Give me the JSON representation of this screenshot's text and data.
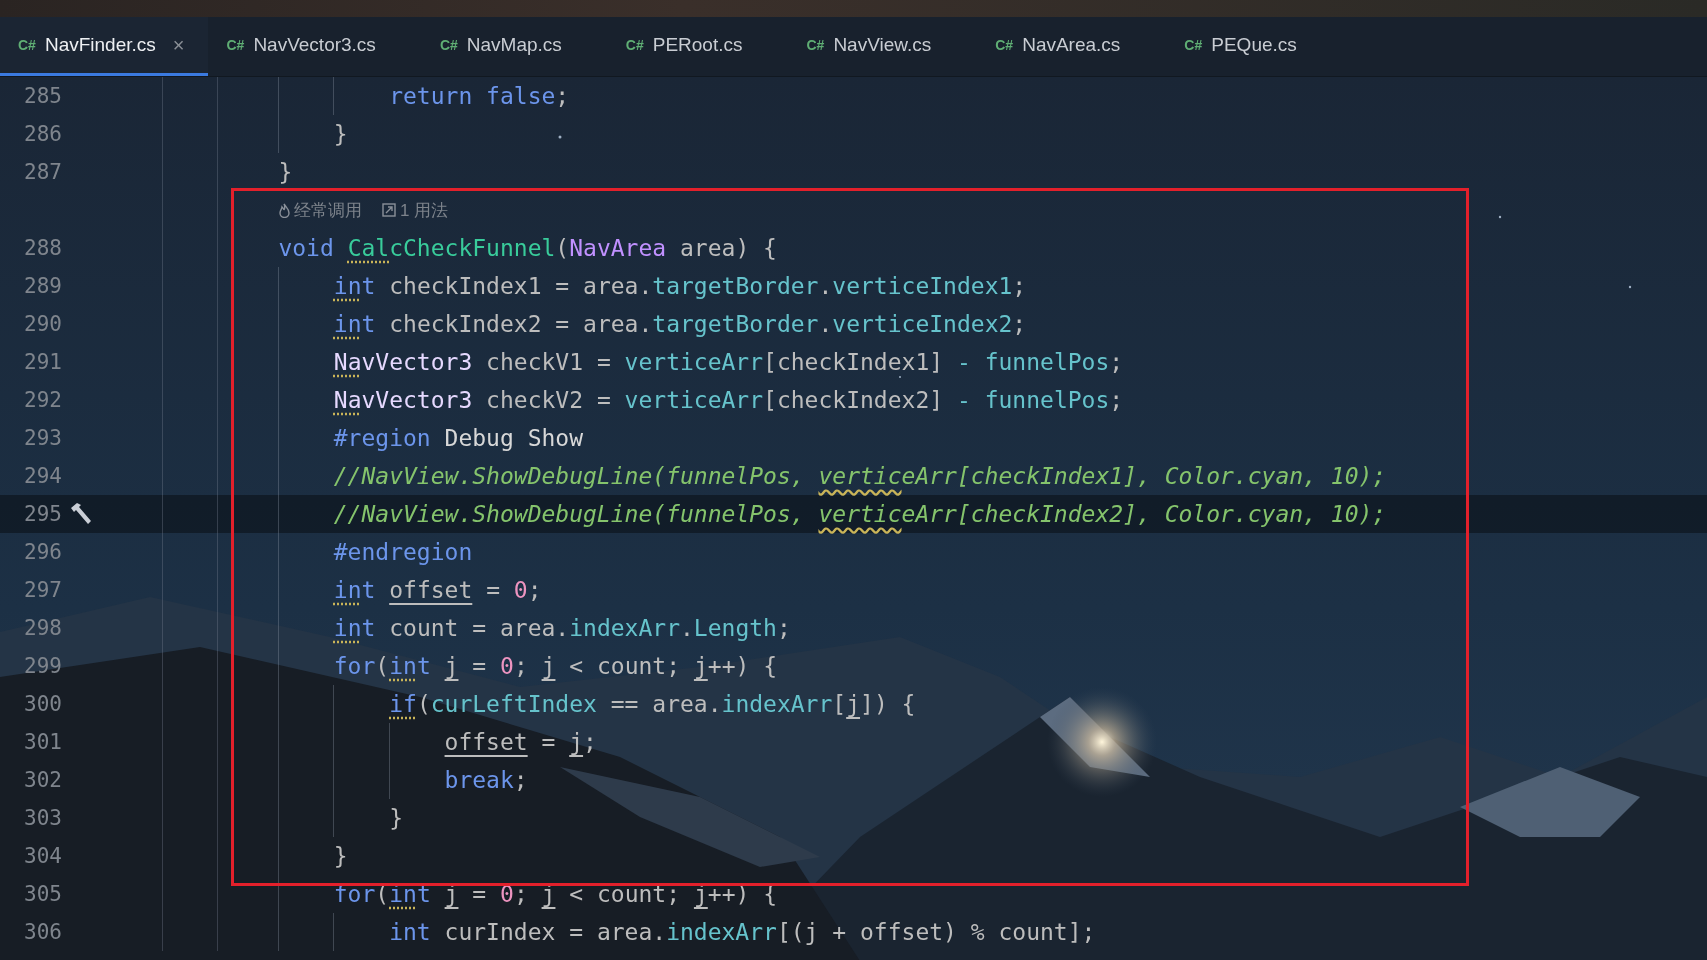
{
  "tabs": [
    {
      "badge": "C#",
      "label": "NavFinder.cs",
      "selected": true,
      "close": "×"
    },
    {
      "badge": "C#",
      "label": "NavVector3.cs",
      "selected": false
    },
    {
      "badge": "C#",
      "label": "NavMap.cs",
      "selected": false
    },
    {
      "badge": "C#",
      "label": "PERoot.cs",
      "selected": false
    },
    {
      "badge": "C#",
      "label": "NavView.cs",
      "selected": false
    },
    {
      "badge": "C#",
      "label": "NavArea.cs",
      "selected": false
    },
    {
      "badge": "C#",
      "label": "PEQue.cs",
      "selected": false
    }
  ],
  "editor": {
    "lines": [
      {
        "kind": "code",
        "number": "285",
        "current": false,
        "build_marker": false,
        "segments": [
          {
            "text": "            return",
            "kind": "keyword"
          },
          {
            "text": " false",
            "kind": "keyword"
          },
          {
            "text": ";",
            "kind": "plain"
          }
        ]
      },
      {
        "kind": "code",
        "number": "286",
        "current": false,
        "build_marker": false,
        "segments": [
          {
            "text": "        }",
            "kind": "plain"
          }
        ]
      },
      {
        "kind": "code",
        "number": "287",
        "current": false,
        "build_marker": false,
        "segments": [
          {
            "text": "    }",
            "kind": "plain"
          }
        ]
      },
      {
        "kind": "hint",
        "hints": [
          {
            "kind": "frequency",
            "text": "经常调用"
          },
          {
            "kind": "usages",
            "text": "1 用法"
          }
        ]
      },
      {
        "kind": "code",
        "number": "288",
        "current": false,
        "build_marker": false,
        "segments": [
          {
            "text": "    void ",
            "kind": "keyword"
          },
          {
            "text": "Cal",
            "kind": "method",
            "warning": true
          },
          {
            "text": "cCheckFunnel",
            "kind": "method"
          },
          {
            "text": "(",
            "kind": "plain"
          },
          {
            "text": "NavArea",
            "kind": "type"
          },
          {
            "text": " area) {",
            "kind": "plain"
          }
        ]
      },
      {
        "kind": "code",
        "number": "289",
        "current": false,
        "build_marker": false,
        "segments": [
          {
            "text": "        in",
            "kind": "keyword",
            "warning": true
          },
          {
            "text": "t",
            "kind": "keyword"
          },
          {
            "text": " checkIndex1 = area.",
            "kind": "plain"
          },
          {
            "text": "targetBorder",
            "kind": "field"
          },
          {
            "text": ".",
            "kind": "plain"
          },
          {
            "text": "verticeIndex1",
            "kind": "field"
          },
          {
            "text": ";",
            "kind": "plain"
          }
        ]
      },
      {
        "kind": "code",
        "number": "290",
        "current": false,
        "build_marker": false,
        "segments": [
          {
            "text": "        in",
            "kind": "keyword",
            "warning": true
          },
          {
            "text": "t",
            "kind": "keyword"
          },
          {
            "text": " checkIndex2 = area.",
            "kind": "plain"
          },
          {
            "text": "targetBorder",
            "kind": "field"
          },
          {
            "text": ".",
            "kind": "plain"
          },
          {
            "text": "verticeIndex2",
            "kind": "field"
          },
          {
            "text": ";",
            "kind": "plain"
          }
        ]
      },
      {
        "kind": "code",
        "number": "291",
        "current": false,
        "build_marker": false,
        "segments": [
          {
            "text": "        Na",
            "kind": "struct",
            "warning": true
          },
          {
            "text": "vVector3",
            "kind": "struct"
          },
          {
            "text": " checkV1 = ",
            "kind": "plain"
          },
          {
            "text": "verticeArr",
            "kind": "field"
          },
          {
            "text": "[checkIndex1] ",
            "kind": "plain"
          },
          {
            "text": "- funnelPos",
            "kind": "field"
          },
          {
            "text": ";",
            "kind": "plain"
          }
        ]
      },
      {
        "kind": "code",
        "number": "292",
        "current": false,
        "build_marker": false,
        "segments": [
          {
            "text": "        Na",
            "kind": "struct",
            "warning": true
          },
          {
            "text": "vVector3",
            "kind": "struct"
          },
          {
            "text": " checkV2 = ",
            "kind": "plain"
          },
          {
            "text": "verticeArr",
            "kind": "field"
          },
          {
            "text": "[checkIndex2] ",
            "kind": "plain"
          },
          {
            "text": "- funnelPos",
            "kind": "field"
          },
          {
            "text": ";",
            "kind": "plain"
          }
        ]
      },
      {
        "kind": "code",
        "number": "293",
        "current": false,
        "build_marker": false,
        "segments": [
          {
            "text": "        #region",
            "kind": "keyword"
          },
          {
            "text": " Debug Show",
            "kind": "bright"
          }
        ]
      },
      {
        "kind": "code",
        "number": "294",
        "current": false,
        "build_marker": false,
        "segments": [
          {
            "text": "        //NavView.ShowDebugLine(funnelPos, ",
            "kind": "comment"
          },
          {
            "text": "vertic",
            "kind": "comment",
            "typo": true
          },
          {
            "text": "eArr[checkIndex1], Color.cyan, 10);",
            "kind": "comment"
          }
        ]
      },
      {
        "kind": "code",
        "number": "295",
        "current": true,
        "build_marker": true,
        "segments": [
          {
            "text": "        //NavView.ShowDebugLine(funnelPos, ",
            "kind": "comment"
          },
          {
            "text": "vertic",
            "kind": "comment",
            "typo": true
          },
          {
            "text": "eArr[checkIndex2], Color.cyan, 10);",
            "kind": "comment"
          }
        ]
      },
      {
        "kind": "code",
        "number": "296",
        "current": false,
        "build_marker": false,
        "segments": [
          {
            "text": "        #endregion",
            "kind": "keyword"
          }
        ]
      },
      {
        "kind": "code",
        "number": "297",
        "current": false,
        "build_marker": false,
        "segments": [
          {
            "text": "        in",
            "kind": "keyword",
            "warning": true
          },
          {
            "text": "t",
            "kind": "keyword"
          },
          {
            "text": " offset",
            "kind": "plain",
            "mutable": true
          },
          {
            "text": " = ",
            "kind": "plain"
          },
          {
            "text": "0",
            "kind": "number"
          },
          {
            "text": ";",
            "kind": "plain"
          }
        ]
      },
      {
        "kind": "code",
        "number": "298",
        "current": false,
        "build_marker": false,
        "segments": [
          {
            "text": "        in",
            "kind": "keyword",
            "warning": true
          },
          {
            "text": "t",
            "kind": "keyword"
          },
          {
            "text": " count = area.",
            "kind": "plain"
          },
          {
            "text": "indexArr",
            "kind": "field"
          },
          {
            "text": ".",
            "kind": "plain"
          },
          {
            "text": "Length",
            "kind": "field"
          },
          {
            "text": ";",
            "kind": "plain"
          }
        ]
      },
      {
        "kind": "code",
        "number": "299",
        "current": false,
        "build_marker": false,
        "segments": [
          {
            "text": "        for",
            "kind": "keyword"
          },
          {
            "text": "(",
            "kind": "plain"
          },
          {
            "text": "in",
            "kind": "keyword",
            "warning": true
          },
          {
            "text": "t",
            "kind": "keyword"
          },
          {
            "text": " j",
            "kind": "plain",
            "mutable": true
          },
          {
            "text": " = ",
            "kind": "plain"
          },
          {
            "text": "0",
            "kind": "number"
          },
          {
            "text": "; ",
            "kind": "plain"
          },
          {
            "text": "j",
            "kind": "plain",
            "mutable": true
          },
          {
            "text": " < count; ",
            "kind": "plain"
          },
          {
            "text": "j",
            "kind": "plain",
            "mutable": true
          },
          {
            "text": "++) {",
            "kind": "plain"
          }
        ]
      },
      {
        "kind": "code",
        "number": "300",
        "current": false,
        "build_marker": false,
        "segments": [
          {
            "text": "            if",
            "kind": "keyword",
            "warning": true
          },
          {
            "text": "(",
            "kind": "plain"
          },
          {
            "text": "curLeftIndex",
            "kind": "field"
          },
          {
            "text": " == area.",
            "kind": "plain"
          },
          {
            "text": "indexArr",
            "kind": "field"
          },
          {
            "text": "[",
            "kind": "plain"
          },
          {
            "text": "j",
            "kind": "plain",
            "mutable": true
          },
          {
            "text": "]) {",
            "kind": "plain"
          }
        ]
      },
      {
        "kind": "code",
        "number": "301",
        "current": false,
        "build_marker": false,
        "segments": [
          {
            "text": "                offset",
            "kind": "plain",
            "mutable": true
          },
          {
            "text": " = ",
            "kind": "plain"
          },
          {
            "text": "j",
            "kind": "plain",
            "mutable": true
          },
          {
            "text": ";",
            "kind": "plain"
          }
        ]
      },
      {
        "kind": "code",
        "number": "302",
        "current": false,
        "build_marker": false,
        "segments": [
          {
            "text": "                break",
            "kind": "keyword"
          },
          {
            "text": ";",
            "kind": "plain"
          }
        ]
      },
      {
        "kind": "code",
        "number": "303",
        "current": false,
        "build_marker": false,
        "segments": [
          {
            "text": "            }",
            "kind": "plain"
          }
        ]
      },
      {
        "kind": "code",
        "number": "304",
        "current": false,
        "build_marker": false,
        "segments": [
          {
            "text": "        }",
            "kind": "plain"
          }
        ]
      },
      {
        "kind": "code",
        "number": "305",
        "current": false,
        "build_marker": false,
        "segments": [
          {
            "text": "        for",
            "kind": "keyword"
          },
          {
            "text": "(",
            "kind": "plain"
          },
          {
            "text": "in",
            "kind": "keyword",
            "warning": true
          },
          {
            "text": "t",
            "kind": "keyword"
          },
          {
            "text": " j",
            "kind": "plain",
            "mutable": true
          },
          {
            "text": " = ",
            "kind": "plain"
          },
          {
            "text": "0",
            "kind": "number"
          },
          {
            "text": "; ",
            "kind": "plain"
          },
          {
            "text": "j",
            "kind": "plain",
            "mutable": true
          },
          {
            "text": " < count; ",
            "kind": "plain"
          },
          {
            "text": "j",
            "kind": "plain",
            "mutable": true
          },
          {
            "text": "++) {",
            "kind": "plain"
          }
        ]
      },
      {
        "kind": "code",
        "number": "306",
        "current": false,
        "build_marker": false,
        "segments": [
          {
            "text": "            int",
            "kind": "keyword"
          },
          {
            "text": " curIndex = area.",
            "kind": "plain"
          },
          {
            "text": "indexArr",
            "kind": "field"
          },
          {
            "text": "[(j + offset) % count];",
            "kind": "plain"
          }
        ]
      }
    ]
  }
}
